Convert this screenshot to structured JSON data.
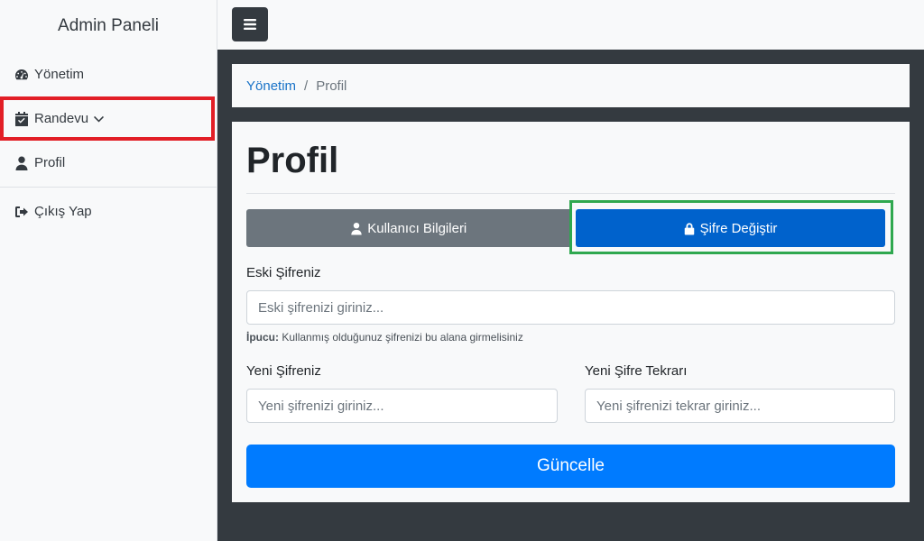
{
  "sidebar": {
    "brand": "Admin Paneli",
    "items": [
      {
        "label": "Yönetim",
        "icon": "tachometer-icon"
      },
      {
        "label": "Randevu",
        "icon": "calendar-check-icon"
      },
      {
        "label": "Profil",
        "icon": "user-icon"
      },
      {
        "label": "Çıkış Yap",
        "icon": "sign-out-icon"
      }
    ]
  },
  "topbar": {
    "toggle_icon": "menu-bars-icon"
  },
  "breadcrumb": {
    "parent": "Yönetim",
    "separator": "/",
    "current": "Profil"
  },
  "page": {
    "title": "Profil"
  },
  "tabs": [
    {
      "label": "Kullanıcı Bilgileri",
      "icon": "user-icon"
    },
    {
      "label": "Şifre Değiştir",
      "icon": "lock-icon"
    }
  ],
  "form": {
    "old_password": {
      "label": "Eski Şifreniz",
      "placeholder": "Eski şifrenizi giriniz...",
      "value": ""
    },
    "hint": {
      "prefix": "İpucu:",
      "text": "Kullanmış olduğunuz şifrenizi bu alana girmelisiniz"
    },
    "new_password": {
      "label": "Yeni Şifreniz",
      "placeholder": "Yeni şifrenizi giriniz...",
      "value": ""
    },
    "new_password_repeat": {
      "label": "Yeni Şifre Tekrarı",
      "placeholder": "Yeni şifrenizi tekrar giriniz...",
      "value": ""
    },
    "submit_label": "Güncelle"
  },
  "colors": {
    "sidebar_bg": "#f8f9fa",
    "main_bg": "#343a40",
    "tab_info": "#6c757d",
    "tab_active": "#0062cc",
    "primary": "#007bff",
    "highlight_red": "#e21e26",
    "highlight_green": "#2fa84f"
  }
}
